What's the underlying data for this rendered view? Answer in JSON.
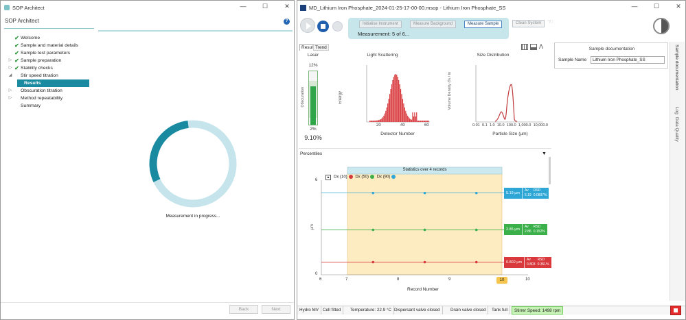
{
  "left_window": {
    "title": "SOP Architect",
    "header": "SOP Architect",
    "tree": [
      {
        "label": "Welcome",
        "state": "done",
        "indent": 0
      },
      {
        "label": "Sample and material details",
        "state": "done",
        "indent": 0
      },
      {
        "label": "Sample test parameters",
        "state": "done",
        "indent": 0
      },
      {
        "label": "Sample preparation",
        "state": "done-collapsed",
        "indent": 0
      },
      {
        "label": "Stability checks",
        "state": "done-collapsed",
        "indent": 0
      },
      {
        "label": "Stir speed titration",
        "state": "expanded",
        "indent": 0
      },
      {
        "label": "Results",
        "state": "selected",
        "indent": 1
      },
      {
        "label": "Obscuration titration",
        "state": "collapsed",
        "indent": 0
      },
      {
        "label": "Method repeatability",
        "state": "collapsed",
        "indent": 0
      },
      {
        "label": "Summary",
        "state": "none",
        "indent": 0
      }
    ],
    "status_text": "Measurement in progress...",
    "back_label": "Back",
    "next_label": "Next",
    "progress_fraction": 0.3
  },
  "right_window": {
    "title": "MD_Lithium Iron Phosphate_2024-01-25-17-00-00.msop - Lithium Iron Phosphate_SS",
    "toolbar": {
      "initialise": "Initialise Instrument",
      "background": "Measure Background",
      "sample": "Measure Sample",
      "clean": "Clean System",
      "measurement_status": "Measurement: 5 of 6..."
    },
    "tabs": [
      "Result",
      "Trend"
    ],
    "laser": {
      "title": "Laser",
      "top_label": "12%",
      "bottom_label": "2%",
      "axis_label": "Obscuration",
      "value": "9.10%",
      "level": 0.72
    },
    "light_scattering": {
      "title": "Light Scattering",
      "xlabel": "Detector Number",
      "ylabel": "Energy",
      "ticks": [
        "20",
        "40",
        "60"
      ]
    },
    "size_distribution": {
      "title": "Size Distribution",
      "xlabel": "Particle Size (µm)",
      "ylabel": "Volume Density (% / lo",
      "ticks": [
        "0.01",
        "0.1",
        "1.0",
        "10.0",
        "100.0",
        "1,000.0",
        "10,000.0"
      ]
    },
    "sample_doc": {
      "title": "Sample documentation",
      "name_label": "Sample Name",
      "name_value": "Lithium Iron Phosphate_SS"
    },
    "side_tabs": [
      "Sample documentation",
      "Log",
      "Data Quality"
    ],
    "percentiles": {
      "title": "Percentiles",
      "stats_label": "Statistics over 4 records",
      "legend": [
        "Dx (10)",
        "Dx (50)",
        "Dx (90)"
      ],
      "legend_colors": [
        "#d9393c",
        "#3bb04a",
        "#2ea7d6"
      ],
      "flags": [
        {
          "value": "5.19 µm",
          "av_label": "Av",
          "rsd_label": "RSD",
          "av": "5.19",
          "rsd": "0.0897%",
          "color": "#2ea7d6"
        },
        {
          "value": "2.85 µm",
          "av_label": "Av",
          "rsd_label": "RSD",
          "av": "2.86",
          "rsd": "0.152%",
          "color": "#3bb04a"
        },
        {
          "value": "0.802 µm",
          "av_label": "Av",
          "rsd_label": "RSD",
          "av": "0.803",
          "rsd": "0.351%",
          "color": "#d9393c"
        }
      ],
      "xlabel": "Record Number",
      "ylabel": "µm",
      "y_ticks": [
        "6",
        "0"
      ],
      "x_ticks": [
        "6",
        "7",
        "8",
        "9",
        "10"
      ],
      "x_highlight": "10",
      "chart_data": {
        "type": "line",
        "x": [
          7,
          8,
          9,
          10
        ],
        "series": [
          {
            "name": "Dx (90)",
            "values": [
              5.19,
              5.19,
              5.19,
              5.19
            ]
          },
          {
            "name": "Dx (50)",
            "values": [
              2.85,
              2.85,
              2.85,
              2.85
            ]
          },
          {
            "name": "Dx (10)",
            "values": [
              0.802,
              0.802,
              0.802,
              0.802
            ]
          }
        ],
        "xlim": [
          6,
          10
        ],
        "ylim": [
          0,
          6
        ]
      }
    },
    "status_bar": [
      "Hydro MV",
      "Cell fitted",
      "Temperature: 22.9 °C",
      "Dispersant valve closed",
      "Drain valve closed",
      "Tank full",
      "Stirrer Speed: 1498 rpm"
    ]
  }
}
